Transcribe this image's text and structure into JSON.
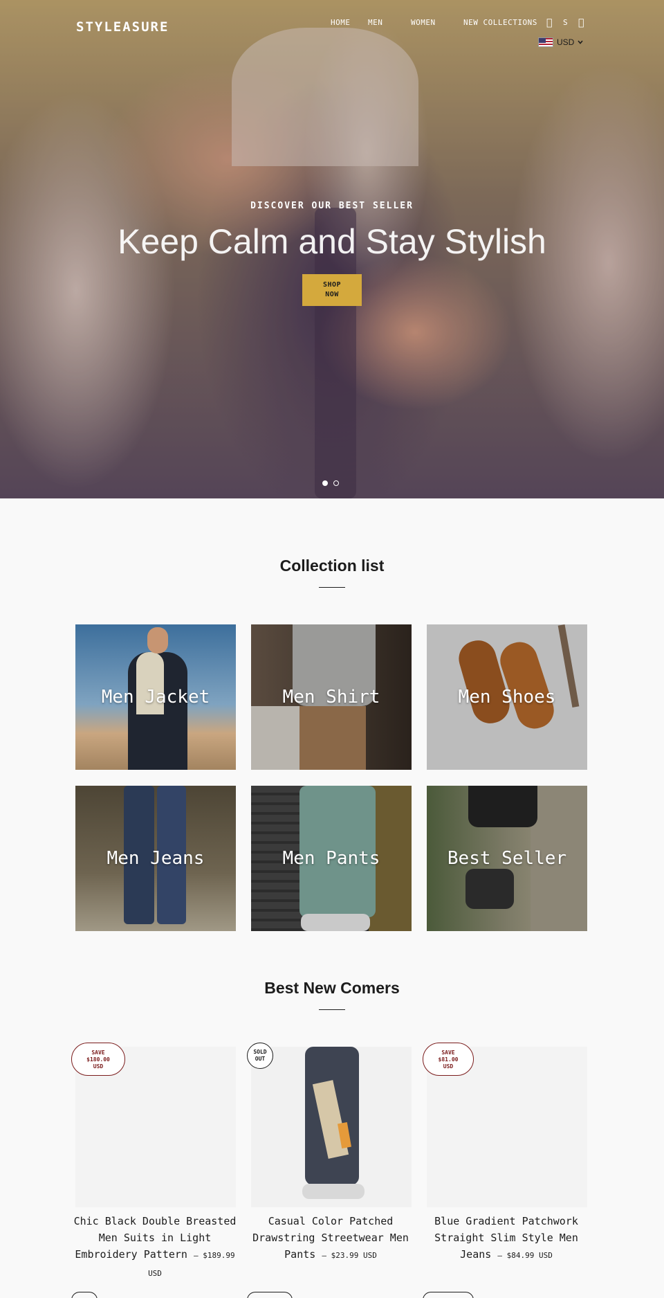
{
  "header": {
    "logo": "STYLEASURE",
    "nav": [
      "HOME",
      "MEN",
      "WOMEN",
      "NEW COLLECTIONS"
    ],
    "search_icon": "",
    "account_label": "S",
    "cart_icon": "",
    "currency": "USD"
  },
  "hero": {
    "subtitle": "DISCOVER OUR BEST SELLER",
    "title": "Keep Calm and Stay Stylish",
    "button_line1": "SHOP",
    "button_line2": "NOW"
  },
  "collections": {
    "title": "Collection list",
    "items": [
      "Men Jacket",
      "Men Shirt",
      "Men Shoes",
      "Men Jeans",
      "Men Pants",
      "Best Seller"
    ]
  },
  "new_comers": {
    "title": "Best New Comers",
    "products": [
      {
        "badge_line1": "SAVE",
        "badge_line2": "$180.00",
        "badge_line3": "USD",
        "name": "Chic Black Double Breasted Men Suits in Light Embroidery Pattern",
        "price": "— $189.99 USD"
      },
      {
        "badge_line1": "SOLD",
        "badge_line2": "OUT",
        "name": "Casual Color Patched Drawstring Streetwear Men Pants",
        "price": "— $23.99 USD"
      },
      {
        "badge_line1": "SAVE",
        "badge_line2": "$81.00",
        "badge_line3": "USD",
        "name": "Blue Gradient Patchwork Straight Slim Style Men Jeans",
        "price": "— $84.99 USD"
      }
    ]
  }
}
